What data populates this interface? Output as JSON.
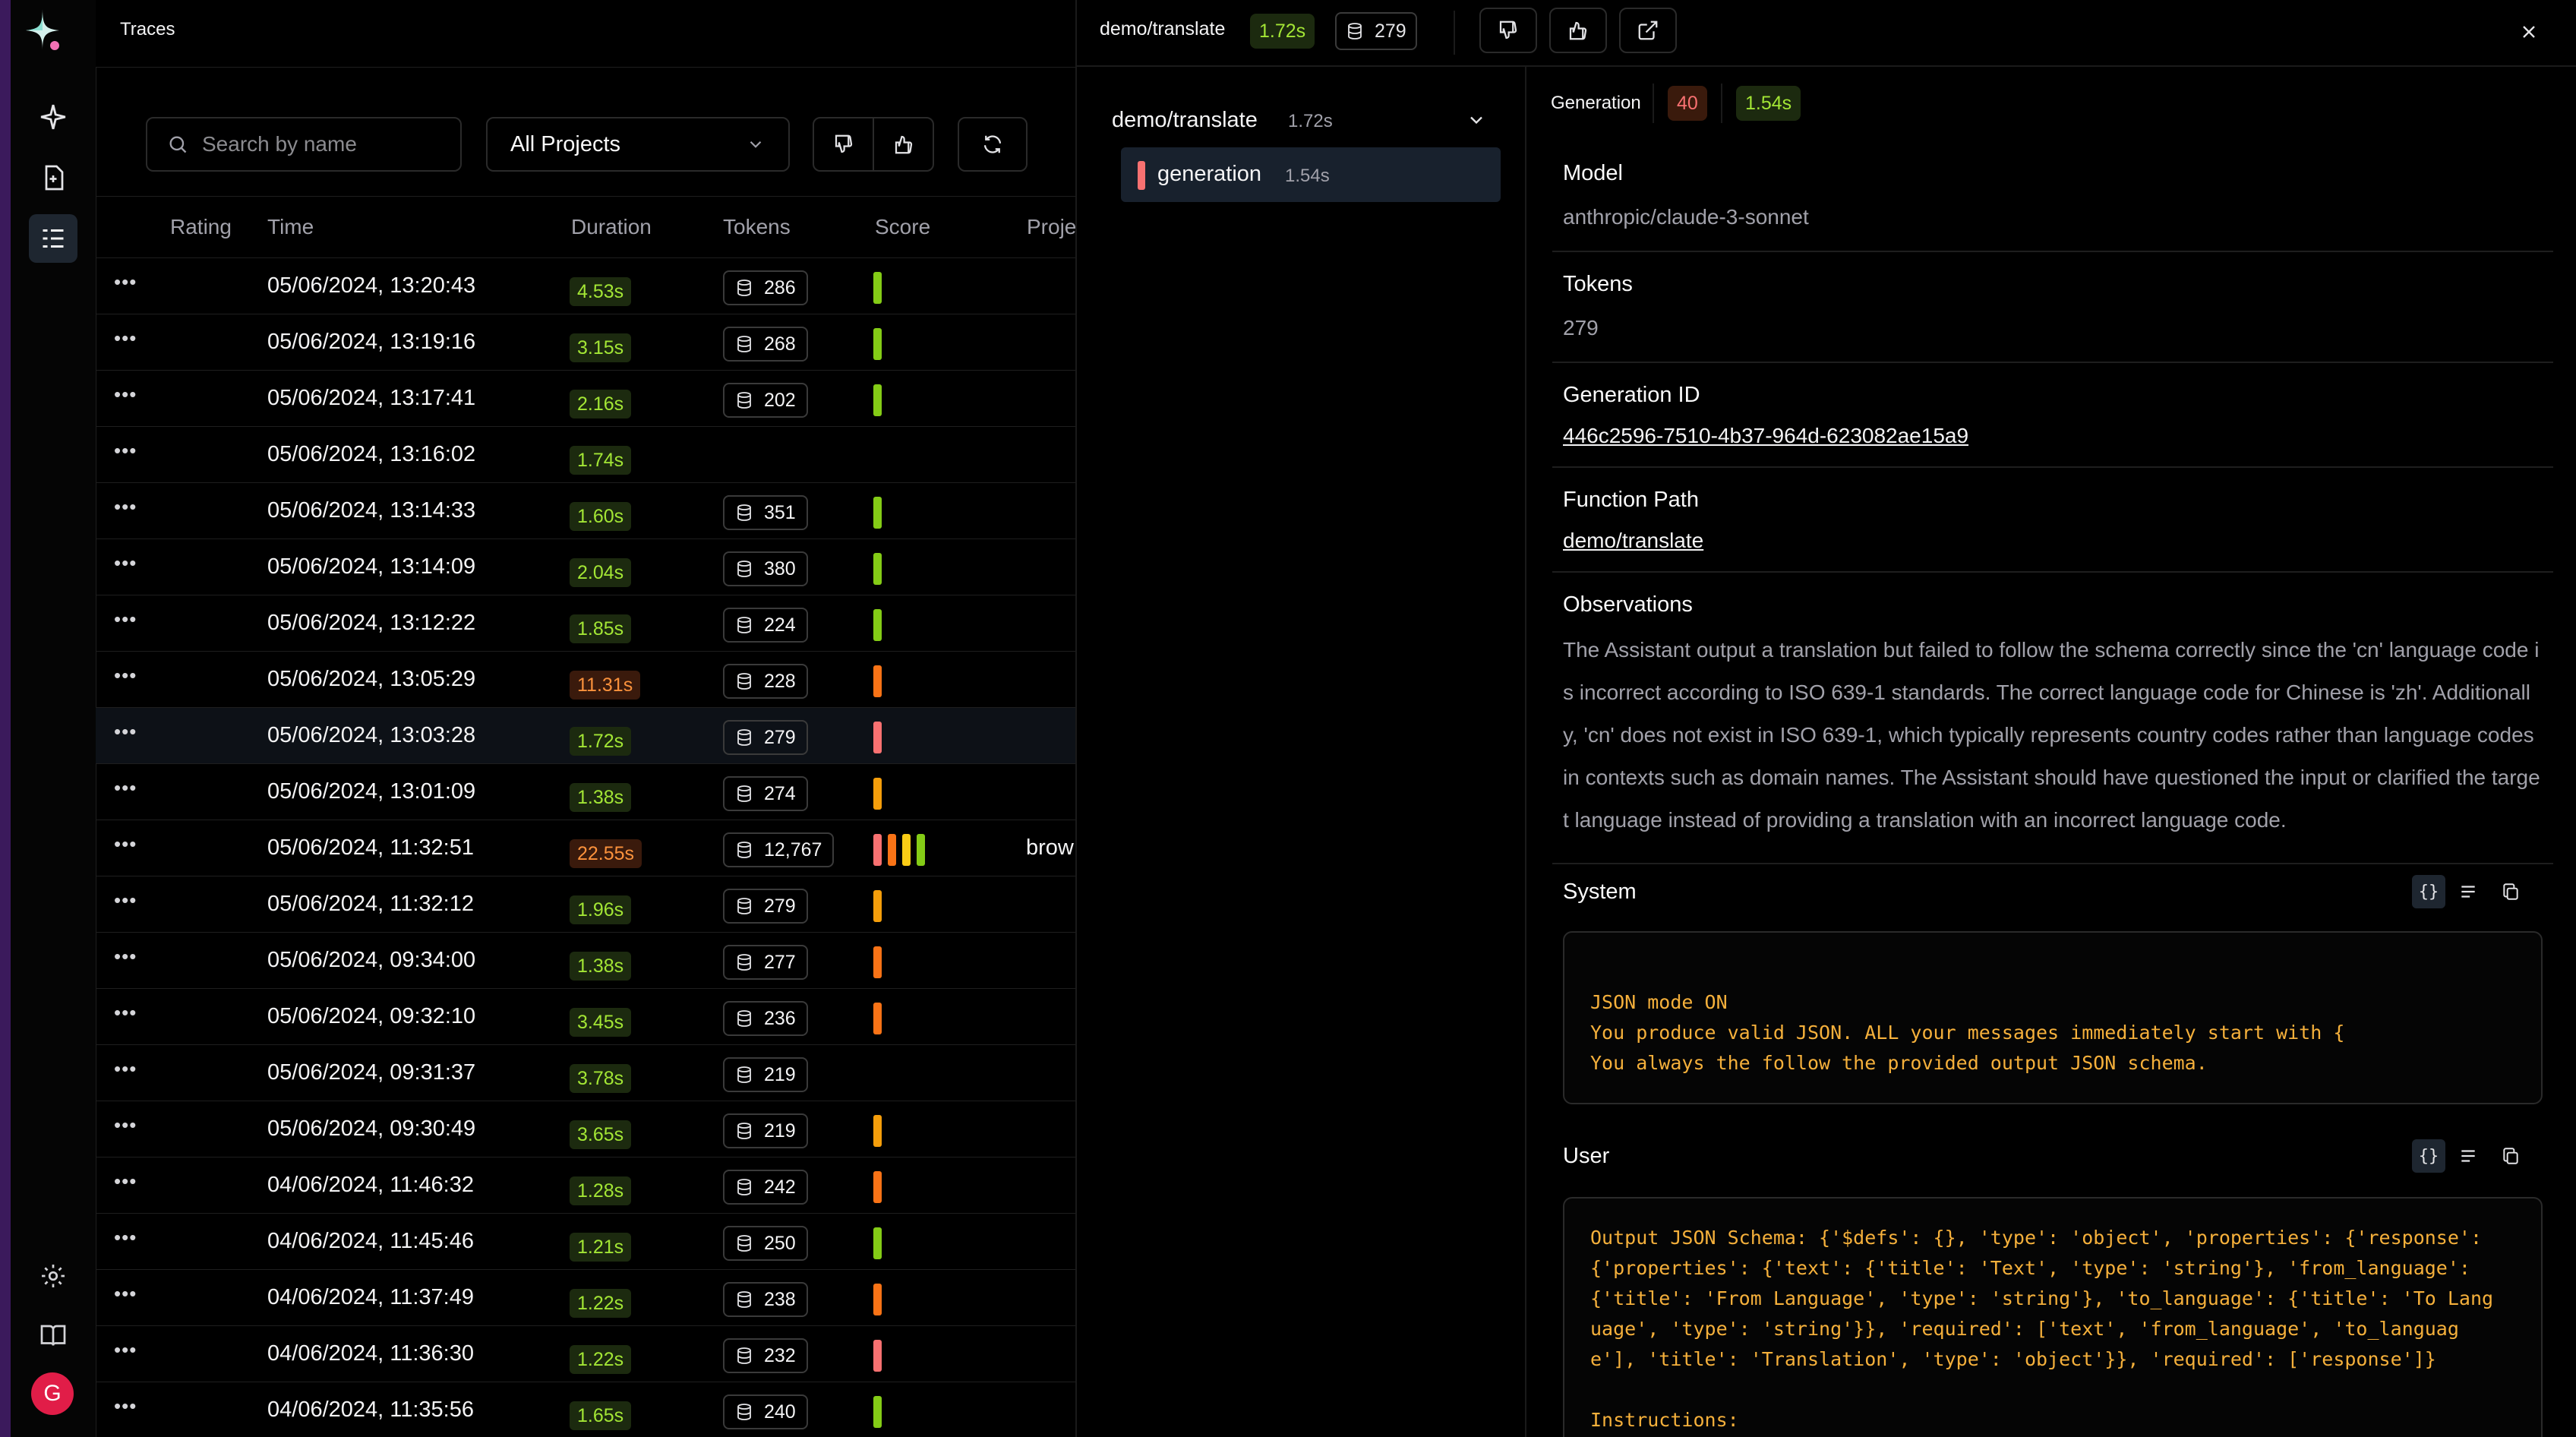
{
  "topbar": {
    "title": "Traces"
  },
  "rail": {
    "avatar_letter": "G"
  },
  "filters": {
    "search_placeholder": "Search by name",
    "project_select": "All Projects"
  },
  "table": {
    "columns": [
      "Rating",
      "Time",
      "Duration",
      "Tokens",
      "Score",
      "Proje"
    ],
    "rows": [
      {
        "time": "05/06/2024, 13:20:43",
        "duration": "4.53s",
        "tokens": "286",
        "dur_color": "green",
        "scores": [
          "#84cc16"
        ]
      },
      {
        "time": "05/06/2024, 13:19:16",
        "duration": "3.15s",
        "tokens": "268",
        "dur_color": "green",
        "scores": [
          "#84cc16"
        ]
      },
      {
        "time": "05/06/2024, 13:17:41",
        "duration": "2.16s",
        "tokens": "202",
        "dur_color": "green",
        "scores": [
          "#84cc16"
        ]
      },
      {
        "time": "05/06/2024, 13:16:02",
        "duration": "1.74s",
        "tokens": "",
        "dur_color": "green",
        "scores": []
      },
      {
        "time": "05/06/2024, 13:14:33",
        "duration": "1.60s",
        "tokens": "351",
        "dur_color": "green",
        "scores": [
          "#84cc16"
        ]
      },
      {
        "time": "05/06/2024, 13:14:09",
        "duration": "2.04s",
        "tokens": "380",
        "dur_color": "green",
        "scores": [
          "#84cc16"
        ]
      },
      {
        "time": "05/06/2024, 13:12:22",
        "duration": "1.85s",
        "tokens": "224",
        "dur_color": "green",
        "scores": [
          "#84cc16"
        ]
      },
      {
        "time": "05/06/2024, 13:05:29",
        "duration": "11.31s",
        "tokens": "228",
        "dur_color": "orange",
        "scores": [
          "#f97316"
        ]
      },
      {
        "time": "05/06/2024, 13:03:28",
        "duration": "1.72s",
        "tokens": "279",
        "dur_color": "green",
        "scores": [
          "#f87171"
        ],
        "selected": true
      },
      {
        "time": "05/06/2024, 13:01:09",
        "duration": "1.38s",
        "tokens": "274",
        "dur_color": "green",
        "scores": [
          "#f59e0b"
        ]
      },
      {
        "time": "05/06/2024, 11:32:51",
        "duration": "22.55s",
        "tokens": "12,767",
        "dur_color": "orange",
        "scores": [
          "#f87171",
          "#f97316",
          "#facc15",
          "#84cc16"
        ],
        "project": "brow"
      },
      {
        "time": "05/06/2024, 11:32:12",
        "duration": "1.96s",
        "tokens": "279",
        "dur_color": "green",
        "scores": [
          "#f59e0b"
        ]
      },
      {
        "time": "05/06/2024, 09:34:00",
        "duration": "1.38s",
        "tokens": "277",
        "dur_color": "green",
        "scores": [
          "#f97316"
        ]
      },
      {
        "time": "05/06/2024, 09:32:10",
        "duration": "3.45s",
        "tokens": "236",
        "dur_color": "green",
        "scores": [
          "#f97316"
        ]
      },
      {
        "time": "05/06/2024, 09:31:37",
        "duration": "3.78s",
        "tokens": "219",
        "dur_color": "green",
        "scores": []
      },
      {
        "time": "05/06/2024, 09:30:49",
        "duration": "3.65s",
        "tokens": "219",
        "dur_color": "green",
        "scores": [
          "#f59e0b"
        ]
      },
      {
        "time": "04/06/2024, 11:46:32",
        "duration": "1.28s",
        "tokens": "242",
        "dur_color": "green",
        "scores": [
          "#f97316"
        ]
      },
      {
        "time": "04/06/2024, 11:45:46",
        "duration": "1.21s",
        "tokens": "250",
        "dur_color": "green",
        "scores": [
          "#84cc16"
        ]
      },
      {
        "time": "04/06/2024, 11:37:49",
        "duration": "1.22s",
        "tokens": "238",
        "dur_color": "green",
        "scores": [
          "#f97316"
        ]
      },
      {
        "time": "04/06/2024, 11:36:30",
        "duration": "1.22s",
        "tokens": "232",
        "dur_color": "green",
        "scores": [
          "#f87171"
        ]
      },
      {
        "time": "04/06/2024, 11:35:56",
        "duration": "1.65s",
        "tokens": "240",
        "dur_color": "green",
        "scores": [
          "#84cc16"
        ]
      }
    ]
  },
  "trace_header": {
    "name": "demo/translate",
    "duration": "1.72s",
    "tokens": "279"
  },
  "tree": {
    "root_name": "demo/translate",
    "root_duration": "1.72s",
    "child_name": "generation",
    "child_duration": "1.54s"
  },
  "detail": {
    "tab": "Generation",
    "score": "40",
    "duration": "1.54s",
    "model_label": "Model",
    "model": "anthropic/claude-3-sonnet",
    "tokens_label": "Tokens",
    "tokens": "279",
    "gen_id_label": "Generation ID",
    "gen_id": "446c2596-7510-4b37-964d-623082ae15a9",
    "func_label": "Function Path",
    "func_path": "demo/translate",
    "obs_label": "Observations",
    "observations": "The Assistant output a translation but failed to follow the schema correctly since the 'cn' language code is incorrect according to ISO 639-1 standards. The correct language code for Chinese is 'zh'. Additionally, 'cn' does not exist in ISO 639-1, which typically represents country codes rather than language codes in contexts such as domain names. The Assistant should have questioned the input or clarified the target language instead of providing a translation with an incorrect language code.",
    "system_label": "System",
    "system_text": "JSON mode ON\nYou produce valid JSON. ALL your messages immediately start with {\nYou always the follow the provided output JSON schema.",
    "user_label": "User",
    "user_text": "Output JSON Schema: {'$defs': {}, 'type': 'object', 'properties': {'response':\n{'properties': {'text': {'title': 'Text', 'type': 'string'}, 'from_language':\n{'title': 'From Language', 'type': 'string'}, 'to_language': {'title': 'To Lang\nuage', 'type': 'string'}}, 'required': ['text', 'from_language', 'to_languag\ne'], 'title': 'Translation', 'type': 'object'}}, 'required': ['response']}\n\nInstructions:"
  },
  "colors": {
    "green_bg": "#1c2a0f",
    "green_fg": "#a3e635",
    "orange_bg": "#3a1a0c",
    "orange_fg": "#fb923c",
    "code": "#f5b03b"
  }
}
